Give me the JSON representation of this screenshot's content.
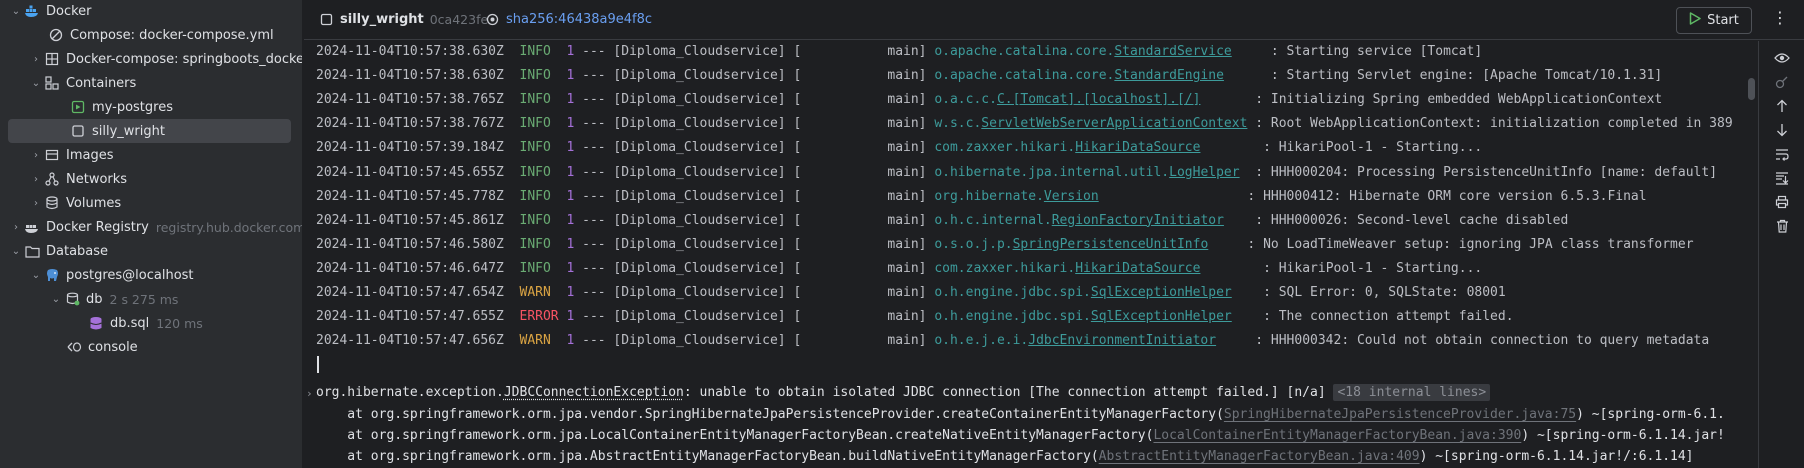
{
  "sidebar": {
    "items": [
      {
        "label": "Docker",
        "sub": ""
      },
      {
        "label": "Compose: docker-compose.yml",
        "sub": ""
      },
      {
        "label": "Docker-compose: springboots_docker",
        "sub": ""
      },
      {
        "label": "Containers",
        "sub": ""
      },
      {
        "label": "my-postgres",
        "sub": ""
      },
      {
        "label": "silly_wright",
        "sub": ""
      },
      {
        "label": "Images",
        "sub": ""
      },
      {
        "label": "Networks",
        "sub": ""
      },
      {
        "label": "Volumes",
        "sub": ""
      },
      {
        "label": "Docker Registry",
        "sub": "registry.hub.docker.com"
      },
      {
        "label": "Database",
        "sub": ""
      },
      {
        "label": "postgres@localhost",
        "sub": ""
      },
      {
        "label": "db",
        "sub": "2 s 275 ms"
      },
      {
        "label": "db.sql",
        "sub": "120 ms"
      },
      {
        "label": "console",
        "sub": ""
      }
    ]
  },
  "toolbar": {
    "container_name": "silly_wright",
    "container_id": "0ca423fe",
    "image_sha": "sha256:46438a9e4f8c",
    "start_label": "Start"
  },
  "logs": [
    {
      "ts": "2024-11-04T10:57:38.630Z",
      "level": "INFO",
      "pid": "1",
      "mid": " --- [Diploma_Cloudservice] [           main] ",
      "logger_pre": "o.apache.catalina.core.",
      "logger_u": "StandardService",
      "pad": "     ",
      "msg": ": Starting service [Tomcat]"
    },
    {
      "ts": "2024-11-04T10:57:38.630Z",
      "level": "INFO",
      "pid": "1",
      "mid": " --- [Diploma_Cloudservice] [           main] ",
      "logger_pre": "o.apache.catalina.core.",
      "logger_u": "StandardEngine",
      "pad": "      ",
      "msg": ": Starting Servlet engine: [Apache Tomcat/10.1.31]"
    },
    {
      "ts": "2024-11-04T10:57:38.765Z",
      "level": "INFO",
      "pid": "1",
      "mid": " --- [Diploma_Cloudservice] [           main] ",
      "logger_pre": "o.a.c.c.",
      "logger_u": "C.[Tomcat].[localhost].[/]",
      "pad": "       ",
      "msg": ": Initializing Spring embedded WebApplicationContext"
    },
    {
      "ts": "2024-11-04T10:57:38.767Z",
      "level": "INFO",
      "pid": "1",
      "mid": " --- [Diploma_Cloudservice] [           main] ",
      "logger_pre": "w.s.c.",
      "logger_u": "ServletWebServerApplicationContext",
      "pad": " ",
      "msg": ": Root WebApplicationContext: initialization completed in 389"
    },
    {
      "ts": "2024-11-04T10:57:39.184Z",
      "level": "INFO",
      "pid": "1",
      "mid": " --- [Diploma_Cloudservice] [           main] ",
      "logger_pre": "com.zaxxer.hikari.",
      "logger_u": "HikariDataSource",
      "pad": "        ",
      "msg": ": HikariPool-1 - Starting..."
    },
    {
      "ts": "2024-11-04T10:57:45.655Z",
      "level": "INFO",
      "pid": "1",
      "mid": " --- [Diploma_Cloudservice] [           main] ",
      "logger_pre": "o.hibernate.jpa.internal.util.",
      "logger_u": "LogHelper",
      "pad": "  ",
      "msg": ": HHH000204: Processing PersistenceUnitInfo [name: default]"
    },
    {
      "ts": "2024-11-04T10:57:45.778Z",
      "level": "INFO",
      "pid": "1",
      "mid": " --- [Diploma_Cloudservice] [           main] ",
      "logger_pre": "org.hibernate.",
      "logger_u": "Version",
      "pad": "                   ",
      "msg": ": HHH000412: Hibernate ORM core version 6.5.3.Final"
    },
    {
      "ts": "2024-11-04T10:57:45.861Z",
      "level": "INFO",
      "pid": "1",
      "mid": " --- [Diploma_Cloudservice] [           main] ",
      "logger_pre": "o.h.c.internal.",
      "logger_u": "RegionFactoryInitiator",
      "pad": "    ",
      "msg": ": HHH000026: Second-level cache disabled"
    },
    {
      "ts": "2024-11-04T10:57:46.580Z",
      "level": "INFO",
      "pid": "1",
      "mid": " --- [Diploma_Cloudservice] [           main] ",
      "logger_pre": "o.s.o.j.p.",
      "logger_u": "SpringPersistenceUnitInfo",
      "pad": "     ",
      "msg": ": No LoadTimeWeaver setup: ignoring JPA class transformer"
    },
    {
      "ts": "2024-11-04T10:57:46.647Z",
      "level": "INFO",
      "pid": "1",
      "mid": " --- [Diploma_Cloudservice] [           main] ",
      "logger_pre": "com.zaxxer.hikari.",
      "logger_u": "HikariDataSource",
      "pad": "        ",
      "msg": ": HikariPool-1 - Starting..."
    },
    {
      "ts": "2024-11-04T10:57:47.654Z",
      "level": "WARN",
      "pid": "1",
      "mid": " --- [Diploma_Cloudservice] [           main] ",
      "logger_pre": "o.h.engine.jdbc.spi.",
      "logger_u": "SqlExceptionHelper",
      "pad": "    ",
      "msg": ": SQL Error: 0, SQLState: 08001"
    },
    {
      "ts": "2024-11-04T10:57:47.655Z",
      "level": "ERROR",
      "pid": "1",
      "mid": " --- [Diploma_Cloudservice] [           main] ",
      "logger_pre": "o.h.engine.jdbc.spi.",
      "logger_u": "SqlExceptionHelper",
      "pad": "    ",
      "msg": ": The connection attempt failed."
    },
    {
      "ts": "2024-11-04T10:57:47.656Z",
      "level": "WARN",
      "pid": "1",
      "mid": " --- [Diploma_Cloudservice] [           main] ",
      "logger_pre": "o.h.e.j.e.i.",
      "logger_u": "JdbcEnvironmentInitiator",
      "pad": "     ",
      "msg": ": HHH000342: Could not obtain connection to query metadata"
    }
  ],
  "exception": {
    "pre": "org.hibernate.exception.",
    "cls": "JDBCConnectionException",
    "msg": ": unable to obtain isolated JDBC connection [The connection attempt failed.] [n/a]",
    "internal": "<18 internal lines>"
  },
  "stack": [
    {
      "pre": "    at org.springframework.orm.jpa.vendor.SpringHibernateJpaPersistenceProvider.createContainerEntityManagerFactory(",
      "link": "SpringHibernateJpaPersistenceProvider.java:75",
      "post": ") ~[spring-orm-6.1."
    },
    {
      "pre": "    at org.springframework.orm.jpa.LocalContainerEntityManagerFactoryBean.createNativeEntityManagerFactory(",
      "link": "LocalContainerEntityManagerFactoryBean.java:390",
      "post": ") ~[spring-orm-6.1.14.jar!"
    },
    {
      "pre": "    at org.springframework.orm.jpa.AbstractEntityManagerFactoryBean.buildNativeEntityManagerFactory(",
      "link": "AbstractEntityManagerFactoryBean.java:409",
      "post": ") ~[spring-orm-6.1.14.jar!/:6.1.14]"
    }
  ],
  "icons": {
    "docker": "whale-icon",
    "compose": "compose-icon",
    "container_running": "container-running-icon",
    "container_stopped": "container-stopped-icon",
    "database": "database-icon",
    "postgres": "elephant-icon"
  },
  "colors": {
    "info": "#6aab73",
    "warn": "#d9a343",
    "error": "#f75464",
    "pid": "#a571d9",
    "logger": "#3d9b9b",
    "link": "#6a9ff1",
    "start_play": "#5fb865"
  }
}
